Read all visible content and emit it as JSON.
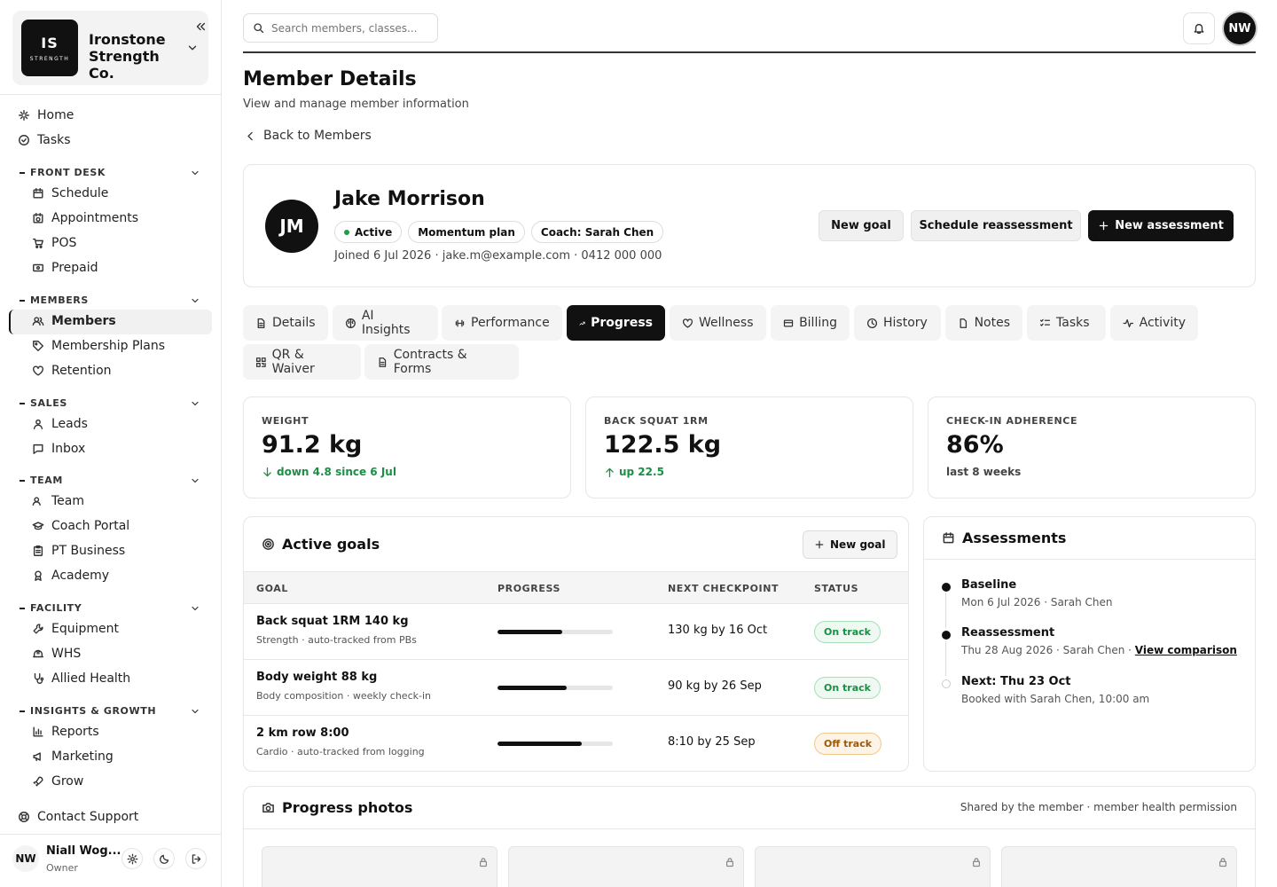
{
  "org": {
    "initials": "IS",
    "tagline": "STRENGTH",
    "name": "Ironstone Strength Co."
  },
  "nav": {
    "home": "Home",
    "tasks": "Tasks",
    "front_desk": {
      "title": "FRONT DESK",
      "items": [
        "Schedule",
        "Appointments",
        "POS",
        "Prepaid"
      ]
    },
    "members": {
      "title": "MEMBERS",
      "items": [
        "Members",
        "Membership Plans",
        "Retention"
      ]
    },
    "sales": {
      "title": "SALES",
      "items": [
        "Leads",
        "Inbox"
      ]
    },
    "team": {
      "title": "TEAM",
      "items": [
        "Team",
        "Coach Portal",
        "PT Business",
        "Academy"
      ]
    },
    "facility": {
      "title": "FACILITY",
      "items": [
        "Equipment",
        "WHS",
        "Allied Health"
      ]
    },
    "insights": {
      "title": "INSIGHTS & GROWTH",
      "items": [
        "Reports",
        "Marketing",
        "Grow"
      ]
    },
    "support": "Contact Support"
  },
  "user": {
    "initials": "NW",
    "name": "Niall Wog...",
    "role": "Owner"
  },
  "search": {
    "placeholder": "Search members, classes..."
  },
  "page": {
    "title": "Member Details",
    "subtitle": "View and manage member information",
    "back": "Back to Members"
  },
  "member": {
    "initials": "JM",
    "name": "Jake Morrison",
    "status": "Active",
    "plan": "Momentum plan",
    "coach": "Coach: Sarah Chen",
    "meta": "Joined 6 Jul 2026 · jake.m@example.com · 0412 000 000",
    "actions": {
      "new_goal": "New goal",
      "reassess": "Schedule reassessment",
      "new_assessment": "New assessment"
    }
  },
  "tabs": [
    "Details",
    "AI Insights",
    "Performance",
    "Progress",
    "Wellness",
    "Billing",
    "History",
    "Notes",
    "Tasks",
    "Activity",
    "QR & Waiver",
    "Contracts & Forms"
  ],
  "stats": [
    {
      "label": "WEIGHT",
      "value": "91.2 kg",
      "note": "down 4.8 since 6 Jul"
    },
    {
      "label": "BACK SQUAT 1RM",
      "value": "122.5 kg",
      "note": "up 22.5"
    },
    {
      "label": "CHECK-IN ADHERENCE",
      "value": "86%",
      "note": "last 8 weeks"
    }
  ],
  "goals": {
    "title": "Active goals",
    "new_goal": "New goal",
    "columns": [
      "GOAL",
      "PROGRESS",
      "NEXT CHECKPOINT",
      "STATUS"
    ],
    "rows": [
      {
        "name": "Back squat 1RM 140 kg",
        "sub": "Strength · auto-tracked from PBs",
        "progress": 0.56,
        "checkpoint": "130 kg by 16 Oct",
        "status": "On track"
      },
      {
        "name": "Body weight 88 kg",
        "sub": "Body composition · weekly check-in",
        "progress": 0.6,
        "checkpoint": "90 kg by 26 Sep",
        "status": "On track"
      },
      {
        "name": "2 km row 8:00",
        "sub": "Cardio · auto-tracked from logging",
        "progress": 0.73,
        "checkpoint": "8:10 by 25 Sep",
        "status": "Off track"
      }
    ]
  },
  "assessments": {
    "title": "Assessments",
    "items": [
      {
        "title": "Baseline",
        "sub": "Mon 6 Jul 2026 · Sarah Chen"
      },
      {
        "title": "Reassessment",
        "sub": "Thu 28 Aug 2026 · Sarah Chen · ",
        "link": "View comparison"
      },
      {
        "title": "Next: Thu 23 Oct",
        "sub": "Booked with Sarah Chen, 10:00 am"
      }
    ]
  },
  "photos": {
    "title": "Progress photos",
    "note": "Shared by the member · member health permission"
  },
  "colors": {
    "accent": "#111111",
    "on_track": "#1a8f45",
    "off_track": "#9a5a08"
  }
}
